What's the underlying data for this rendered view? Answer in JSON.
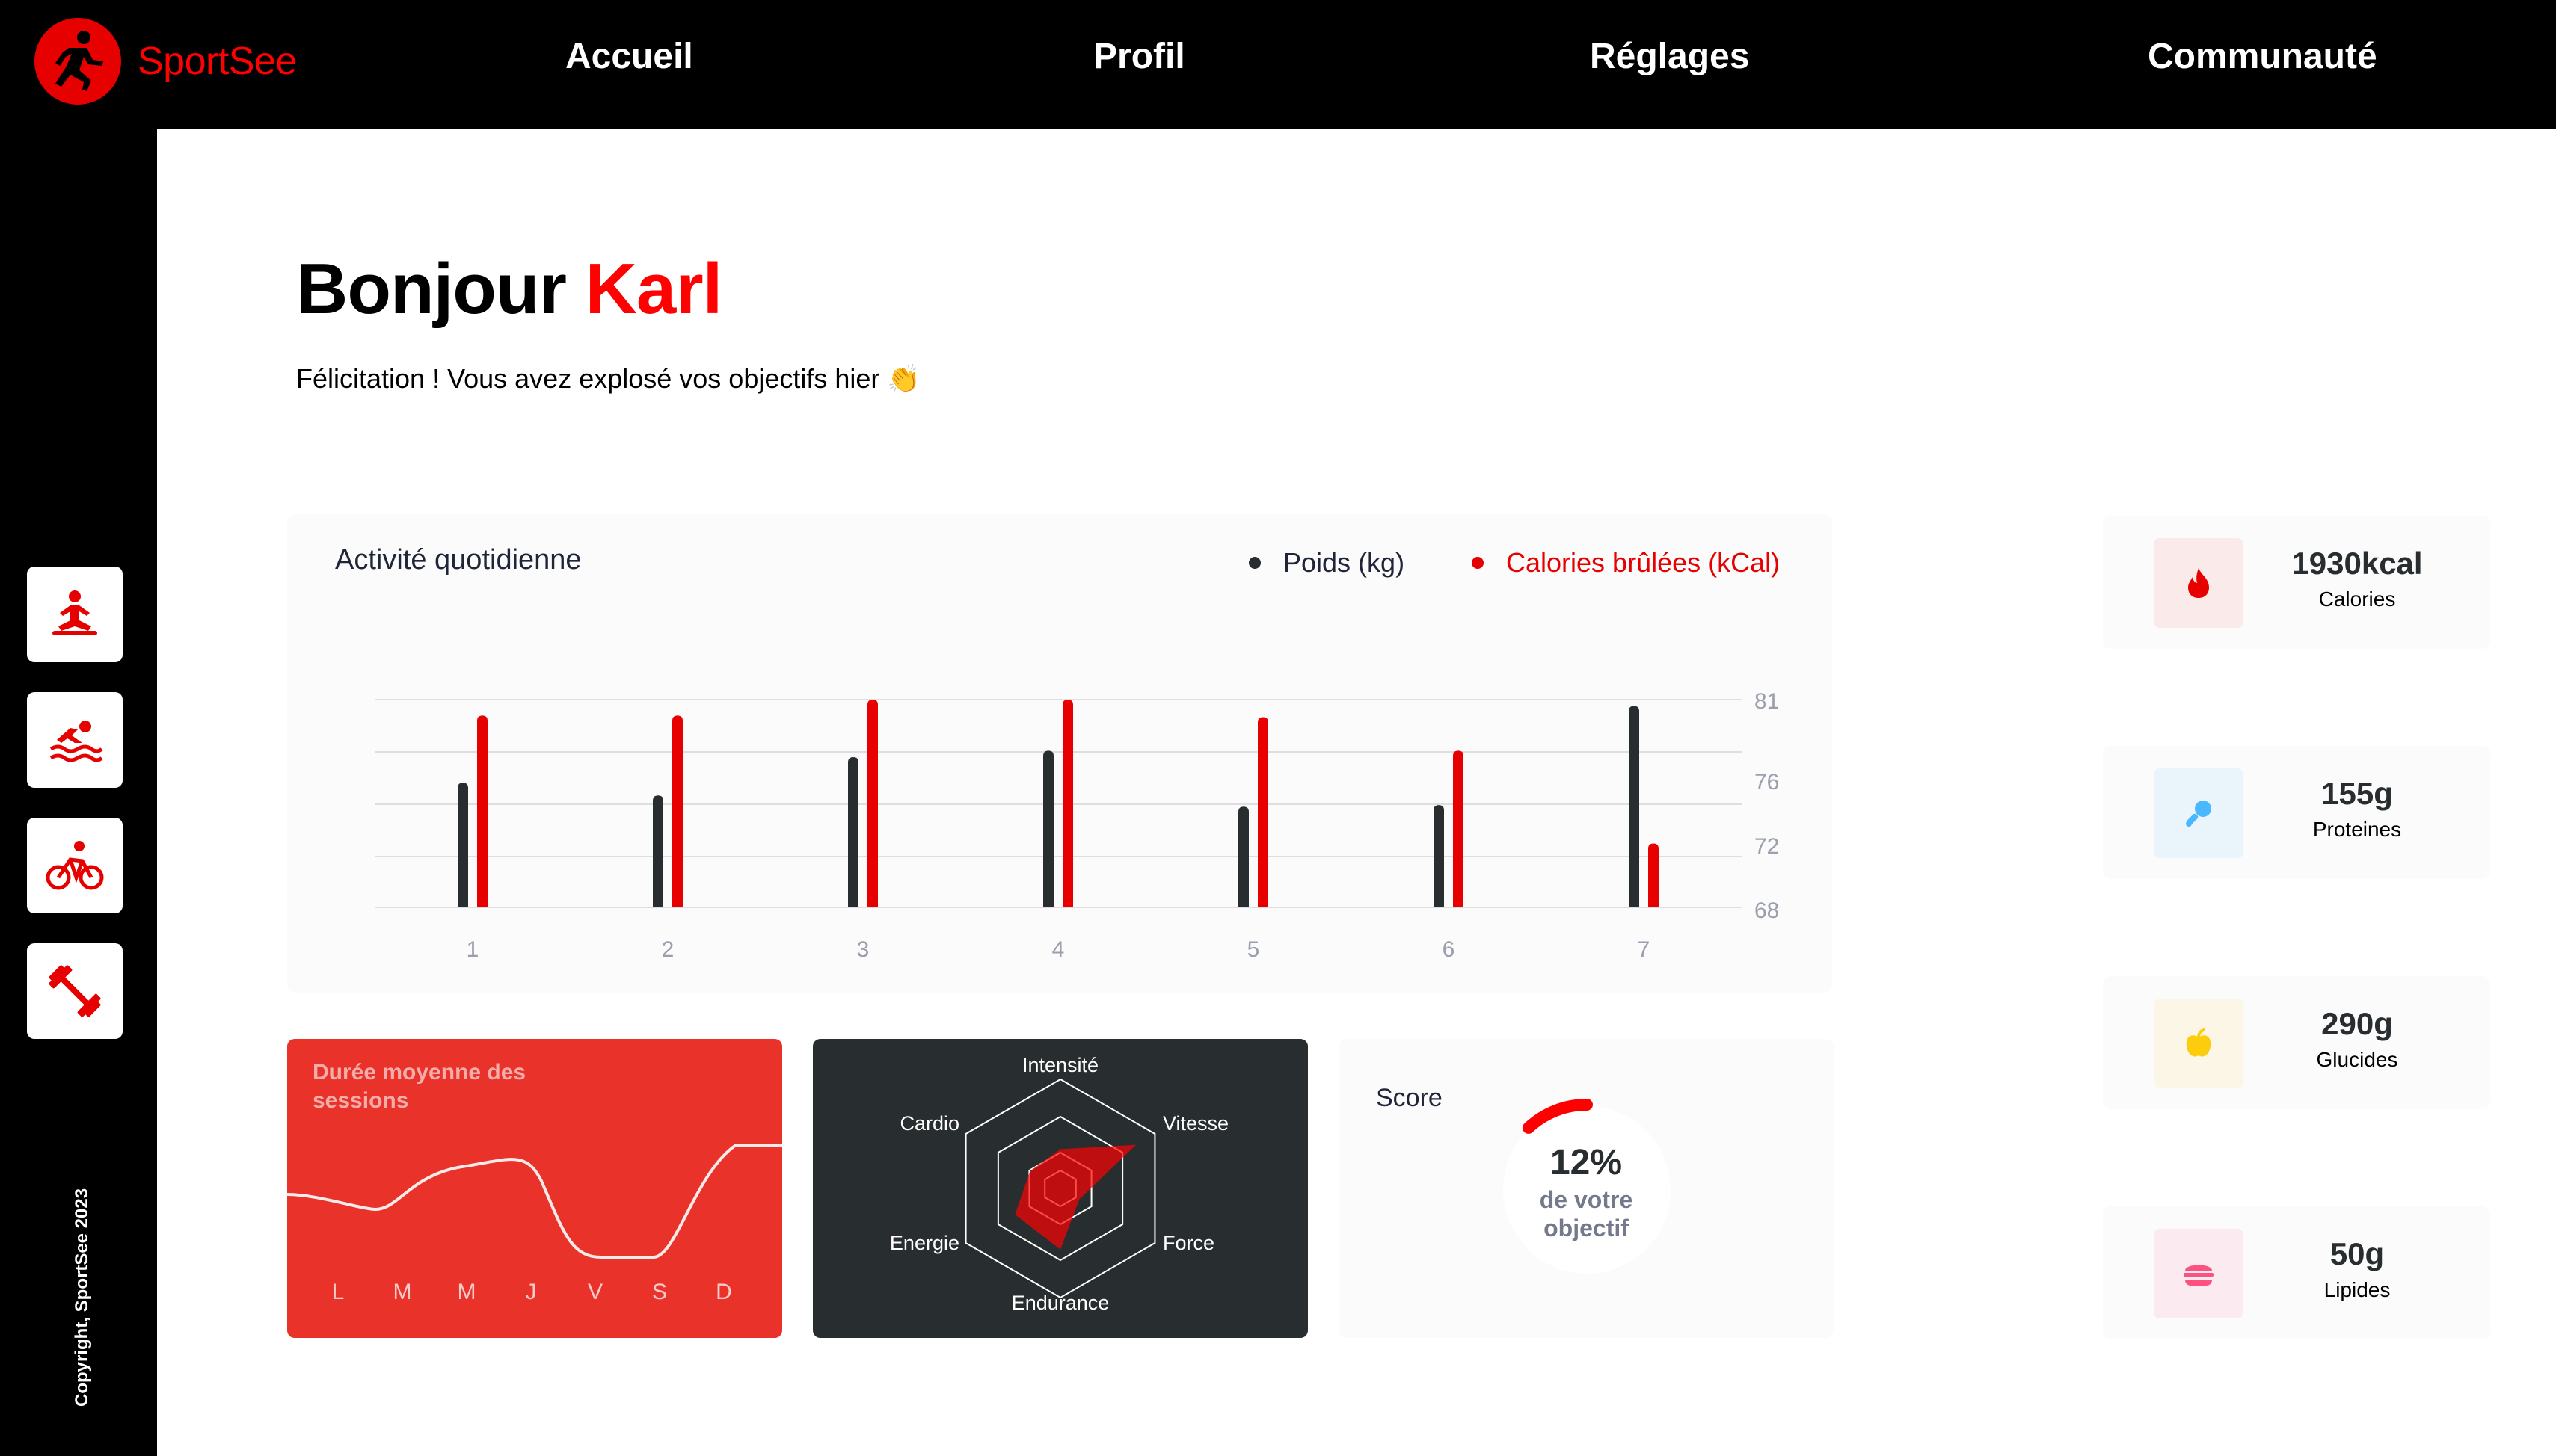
{
  "app": {
    "name": "SportSee"
  },
  "nav": {
    "items": [
      "Accueil",
      "Profil",
      "Réglages",
      "Communauté"
    ]
  },
  "sidebar": {
    "icons": [
      "yoga-icon",
      "swimming-icon",
      "cycling-icon",
      "dumbbell-icon"
    ],
    "copyright": "Copyright, SportSee 2023"
  },
  "greeting": {
    "hello": "Bonjour",
    "name": "Karl",
    "message": "Félicitation ! Vous avez explosé vos objectifs hier 👏"
  },
  "activity": {
    "title": "Activité quotidienne",
    "legend_weight": "Poids (kg)",
    "legend_calories": "Calories brûlées (kCal)",
    "colors": {
      "weight": "#282d30",
      "calories": "#e60000"
    }
  },
  "chart_data": [
    {
      "type": "bar",
      "title": "Activité quotidienne",
      "categories": [
        "1",
        "2",
        "3",
        "4",
        "5",
        "6",
        "7"
      ],
      "y_ticks": [
        "81",
        "76",
        "72",
        "68"
      ],
      "ylim": [
        68,
        81
      ],
      "series": [
        {
          "name": "Poids (kg)",
          "values": [
            75.8,
            75,
            77.4,
            77.8,
            74.3,
            74.4,
            80.6
          ]
        },
        {
          "name": "Calories brûlées (kCal)",
          "values": [
            80.0,
            80.0,
            81.0,
            81.0,
            79.9,
            77.8,
            72.0
          ]
        }
      ],
      "grid": true,
      "legend": "top-right"
    },
    {
      "type": "line",
      "title": "Durée moyenne des sessions",
      "categories": [
        "L",
        "M",
        "M",
        "J",
        "V",
        "S",
        "D"
      ],
      "values": [
        30,
        23,
        45,
        50,
        0,
        0,
        60
      ]
    },
    {
      "type": "radar",
      "categories": [
        "Intensité",
        "Vitesse",
        "Force",
        "Endurance",
        "Energie",
        "Cardio"
      ],
      "values": [
        90,
        200,
        50,
        140,
        120,
        80
      ]
    },
    {
      "type": "pie",
      "title": "Score",
      "values": [
        12
      ],
      "label": "12%"
    }
  ],
  "sessions": {
    "title": "Durée moyenne des sessions",
    "days": [
      "L",
      "M",
      "M",
      "J",
      "V",
      "S",
      "D"
    ]
  },
  "performance": {
    "labels": [
      "Intensité",
      "Vitesse",
      "Force",
      "Endurance",
      "Energie",
      "Cardio"
    ]
  },
  "score": {
    "title": "Score",
    "value": "12%",
    "line1": "de votre",
    "line2": "objectif"
  },
  "key_data": [
    {
      "value": "1930kcal",
      "label": "Calories",
      "icon": "flame-icon",
      "bg": "#fbeaea",
      "color": "#e60000"
    },
    {
      "value": "155g",
      "label": "Proteines",
      "icon": "chicken-icon",
      "bg": "#e9f4fb",
      "color": "#4ab8ff"
    },
    {
      "value": "290g",
      "label": "Glucides",
      "icon": "apple-icon",
      "bg": "#fbf6e5",
      "color": "#fdcc0c"
    },
    {
      "value": "50g",
      "label": "Lipides",
      "icon": "burger-icon",
      "bg": "#fbeaef",
      "color": "#fd5181"
    }
  ]
}
